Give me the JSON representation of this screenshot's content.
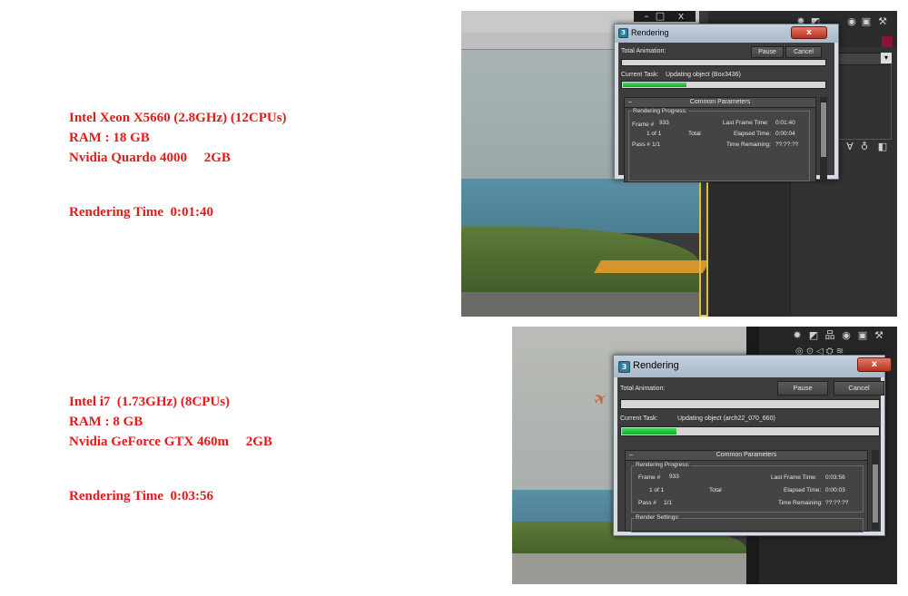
{
  "configs": [
    {
      "cpu": "Intel Xeon X5660 (2.8GHz) (12CPUs)",
      "ram": "RAM : 18 GB",
      "gpu": "Nvidia Quardo 4000     2GB",
      "render_time": "Rendering Time  0:01:40"
    },
    {
      "cpu": "Intel i7  (1.73GHz) (8CPUs)",
      "ram": "RAM : 8 GB",
      "gpu": "Nvidia GeForce GTX 460m     2GB",
      "render_time": "Rendering Time  0:03:56"
    }
  ],
  "dialogs": [
    {
      "title": "Rendering",
      "total_animation_label": "Total Animation:",
      "current_task_label": "Current Task:",
      "current_task_value": "Updating object (Box3436)",
      "task_progress": 0.32,
      "pause_label": "Pause",
      "cancel_label": "Cancel",
      "rollout_title": "Common Parameters",
      "progress_group": "Rendering Progress:",
      "frame_label": "Frame #",
      "frame_value": "933",
      "of_text": "1 of 1",
      "total_text": "Total",
      "pass_label": "Pass #",
      "pass_value": "1/1",
      "last_frame_label": "Last Frame Time:",
      "last_frame_value": "0:01:40",
      "elapsed_label": "Elapsed Time:",
      "elapsed_value": "0:00:04",
      "remaining_label": "Time Remaining:",
      "remaining_value": "??:??:??"
    },
    {
      "title": "Rendering",
      "total_animation_label": "Total Animation:",
      "current_task_label": "Current Task:",
      "current_task_value": "Updating object (arch22_070_660)",
      "task_progress": 0.22,
      "pause_label": "Pause",
      "cancel_label": "Cancel",
      "rollout_title": "Common Parameters",
      "progress_group": "Rendering Progress:",
      "frame_label": "Frame #",
      "frame_value": "933",
      "of_text": "1 of 1",
      "total_text": "Total",
      "pass_label": "Pass #",
      "pass_value": "1/1",
      "last_frame_label": "Last Frame Time:",
      "last_frame_value": "0:03:56",
      "elapsed_label": "Elapsed Time:",
      "elapsed_value": "0:00:03",
      "remaining_label": "Time Remaining:",
      "remaining_value": "??:??:??",
      "render_settings_label": "Render Settings:"
    }
  ],
  "window_controls": {
    "minimize": "–",
    "maximize": "□",
    "close": "x"
  },
  "icons": [
    "render-setup-icon",
    "render-frame-icon",
    "hierarchy-icon",
    "motion-icon",
    "display-icon",
    "utilities-icon"
  ],
  "colors": {
    "spec_text": "#e51a1a",
    "progress_green": "#1fbf3a",
    "close_red": "#c0392b"
  }
}
